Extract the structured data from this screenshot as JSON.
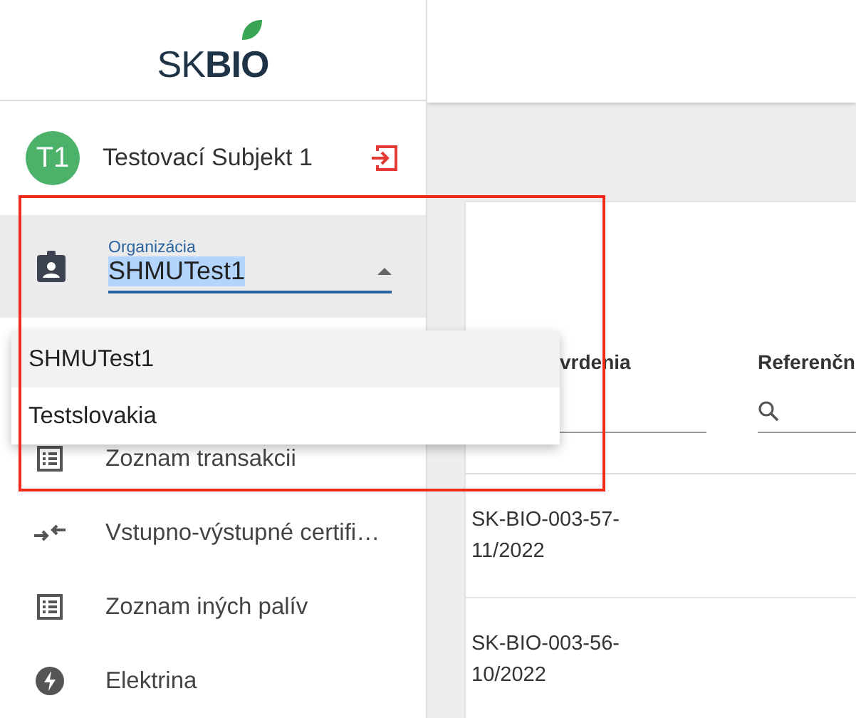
{
  "logo": {
    "text_light": "SK",
    "text_bold": "BIO"
  },
  "user": {
    "initials": "T1",
    "name": "Testovací Subjekt 1"
  },
  "organization_select": {
    "label": "Organizácia",
    "value": "SHMUTest1",
    "expanded": true,
    "options": [
      {
        "label": "SHMUTest1",
        "selected": true
      },
      {
        "label": "Testslovakia",
        "selected": false
      }
    ]
  },
  "menu": [
    {
      "kind": "list",
      "label": "Zoznam transakcii"
    },
    {
      "kind": "exchange",
      "label": "Vstupno-výstupné certifi…"
    },
    {
      "kind": "list",
      "label": "Zoznam iných palív"
    },
    {
      "kind": "bolt",
      "label": "Elektrina"
    }
  ],
  "table": {
    "columns": [
      {
        "label": "vrdenia",
        "kind": "plain"
      },
      {
        "label": "Referenčn",
        "kind": "search"
      }
    ],
    "rows": [
      {
        "cells": [
          "SK-BIO-003-57-11/2022"
        ]
      },
      {
        "cells": [
          "SK-BIO-003-56-10/2022"
        ]
      }
    ]
  }
}
